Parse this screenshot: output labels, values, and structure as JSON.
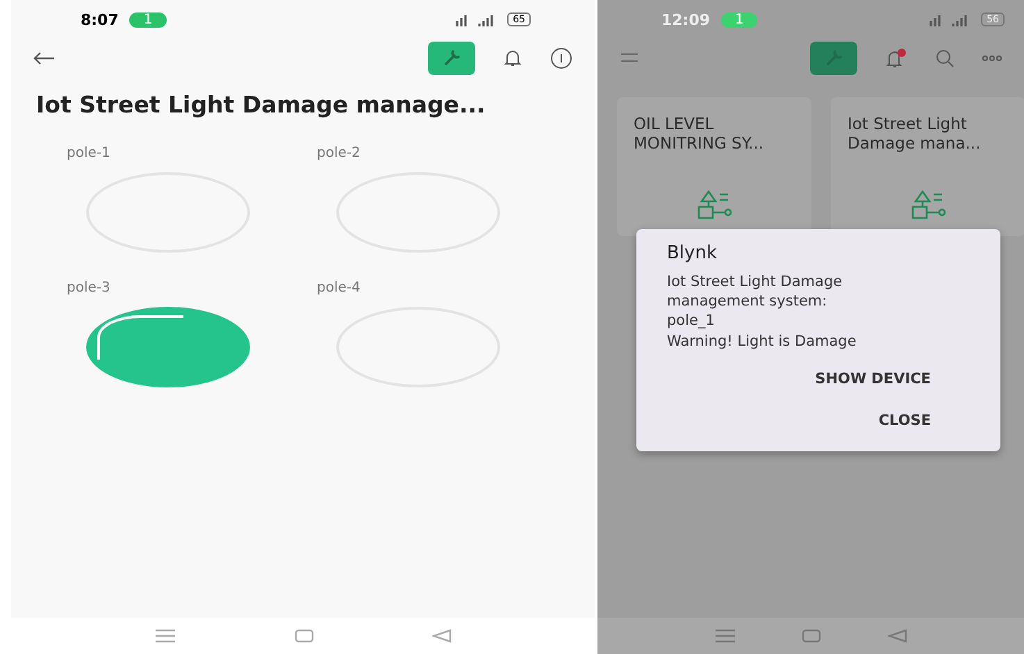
{
  "left_screen": {
    "status_bar": {
      "time": "8:07",
      "call_badge": "1",
      "battery": "65"
    },
    "title": "Iot Street Light Damage manage...",
    "poles": [
      {
        "label": "pole-1",
        "on": false
      },
      {
        "label": "pole-2",
        "on": false
      },
      {
        "label": "pole-3",
        "on": true
      },
      {
        "label": "pole-4",
        "on": false
      }
    ]
  },
  "right_screen": {
    "status_bar": {
      "time": "12:09",
      "call_badge": "1",
      "battery": "56"
    },
    "notification_dot": true,
    "devices": [
      {
        "name": "OIL LEVEL MONITRING SY..."
      },
      {
        "name": "Iot Street Light Damage mana..."
      }
    ],
    "dialog": {
      "title": "Blynk",
      "lines": [
        "Iot Street Light Damage",
        "management system:",
        "pole_1",
        "Warning! Light is Damage"
      ],
      "buttons": [
        "SHOW DEVICE",
        "CLOSE"
      ]
    }
  }
}
